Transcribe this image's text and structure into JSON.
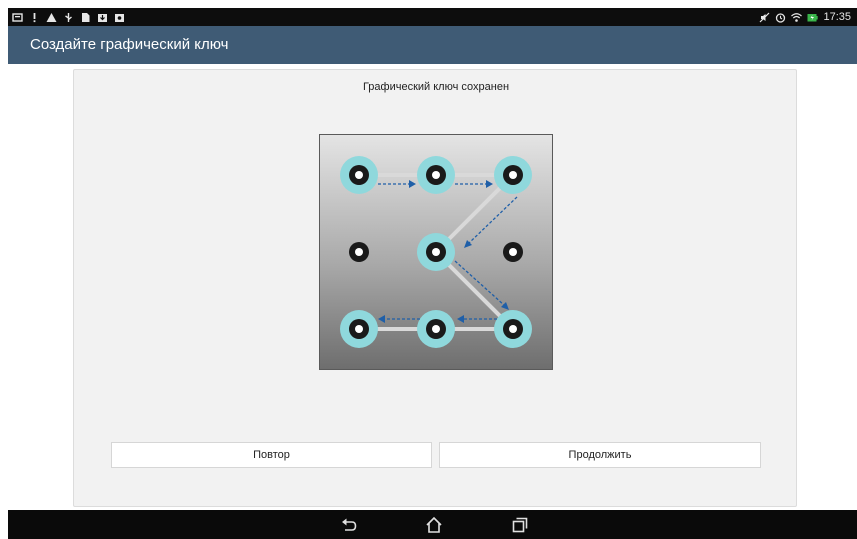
{
  "status_bar": {
    "time": "17:35",
    "left_icons": [
      "notification-message-icon",
      "alert-icon",
      "warning-icon",
      "usb-icon",
      "file-icon",
      "download-icon",
      "photo-icon"
    ],
    "right_icons": [
      "mute-icon",
      "alarm-icon",
      "wifi-icon",
      "battery-charging-icon"
    ]
  },
  "action_bar": {
    "title": "Создайте графический ключ"
  },
  "card": {
    "header": "Графический ключ сохранен",
    "buttons": {
      "retry": "Повтор",
      "continue": "Продолжить"
    }
  },
  "pattern": {
    "grid": 3,
    "sequence": [
      1,
      2,
      3,
      5,
      9,
      8,
      7
    ],
    "colors": {
      "selected_ring": "#8fd8dc",
      "path_line": "#d9d9d9",
      "arrow": "#1f5fa8",
      "dot": "#1a1a1a"
    }
  },
  "nav_bar": {
    "icons": [
      "back-icon",
      "home-icon",
      "recent-apps-icon"
    ]
  }
}
